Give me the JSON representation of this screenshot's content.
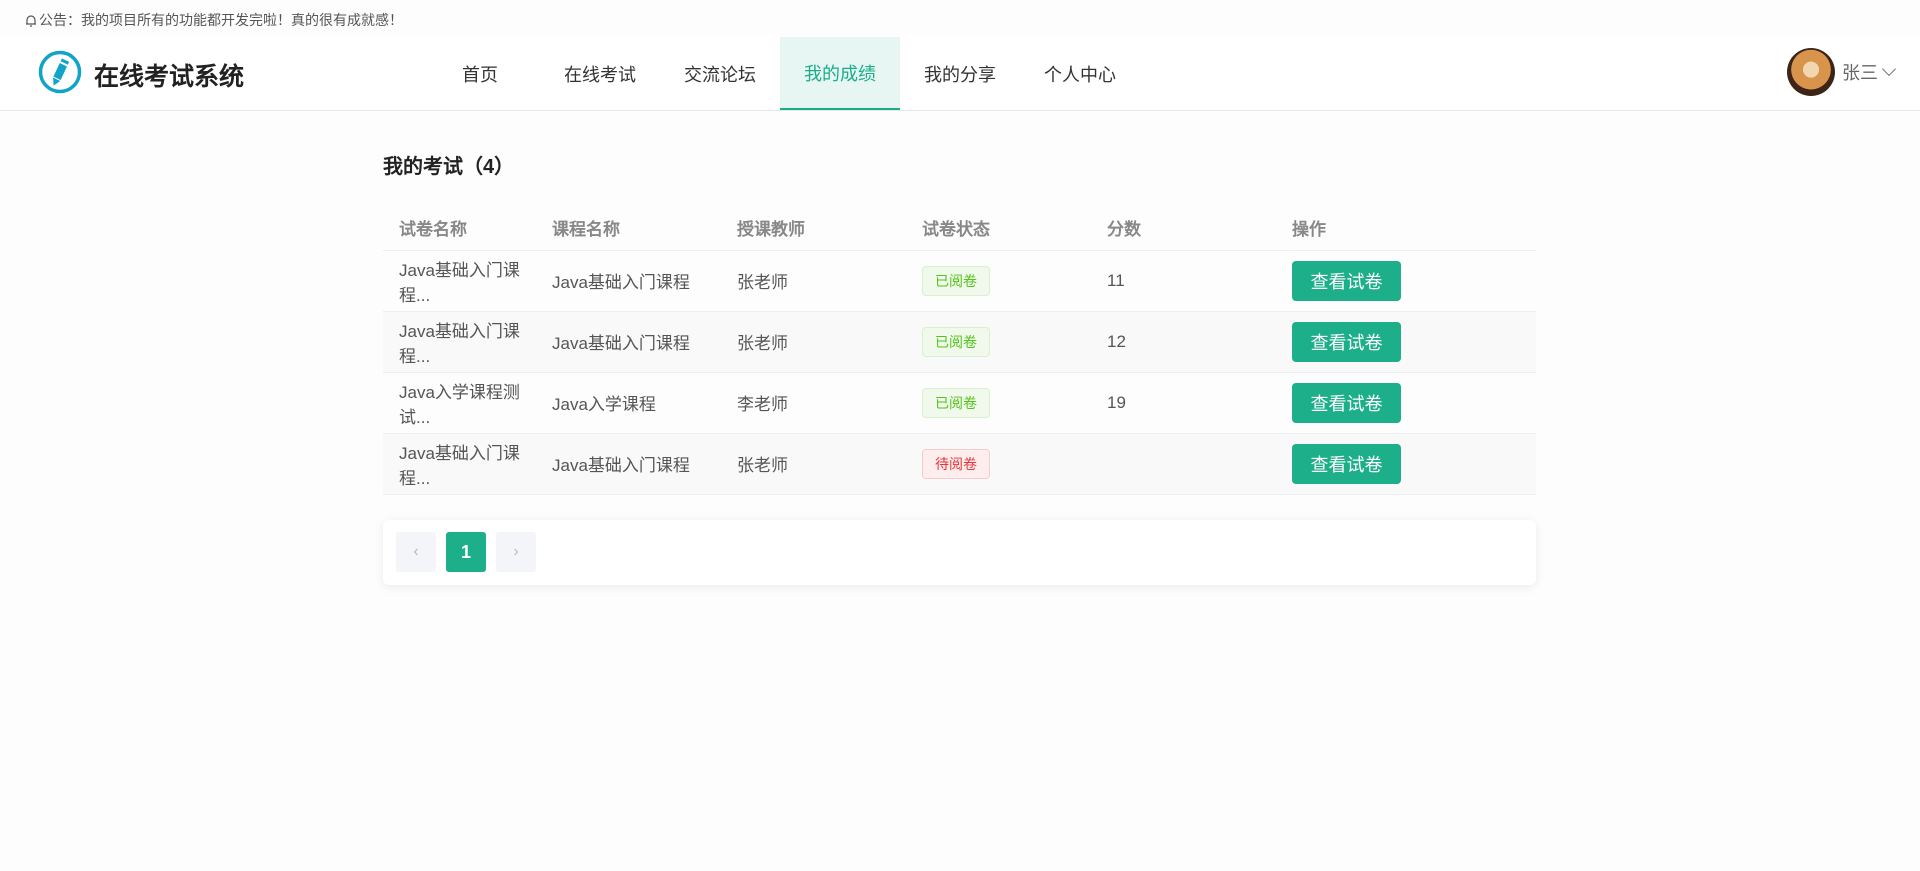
{
  "notice": {
    "icon": "bell-icon",
    "text": "公告：我的项目所有的功能都开发完啦！真的很有成就感！"
  },
  "header": {
    "title": "在线考试系统",
    "nav": [
      {
        "label": "首页"
      },
      {
        "label": "在线考试"
      },
      {
        "label": "交流论坛"
      },
      {
        "label": "我的成绩",
        "active": true
      },
      {
        "label": "我的分享"
      },
      {
        "label": "个人中心"
      }
    ],
    "user": {
      "name": "张三"
    }
  },
  "main": {
    "title": "我的考试（4）",
    "columns": [
      "试卷名称",
      "课程名称",
      "授课教师",
      "试卷状态",
      "分数",
      "操作"
    ],
    "rows": [
      {
        "paper": "Java基础入门课程...",
        "course": "Java基础入门课程",
        "teacher": "张老师",
        "status": "已阅卷",
        "score": "11",
        "action": "查看试卷"
      },
      {
        "paper": "Java基础入门课程...",
        "course": "Java基础入门课程",
        "teacher": "张老师",
        "status": "已阅卷",
        "score": "12",
        "action": "查看试卷"
      },
      {
        "paper": "Java入学课程测试...",
        "course": "Java入学课程",
        "teacher": "李老师",
        "status": "已阅卷",
        "score": "19",
        "action": "查看试卷"
      },
      {
        "paper": "Java基础入门课程...",
        "course": "Java基础入门课程",
        "teacher": "张老师",
        "status": "待阅卷",
        "score": "",
        "action": "查看试卷"
      }
    ]
  },
  "pagination": {
    "prev": "‹",
    "current": "1",
    "next": "›"
  },
  "colors": {
    "accent": "#1caf8a",
    "ok": "#52c41a",
    "wait": "#e6353a"
  }
}
